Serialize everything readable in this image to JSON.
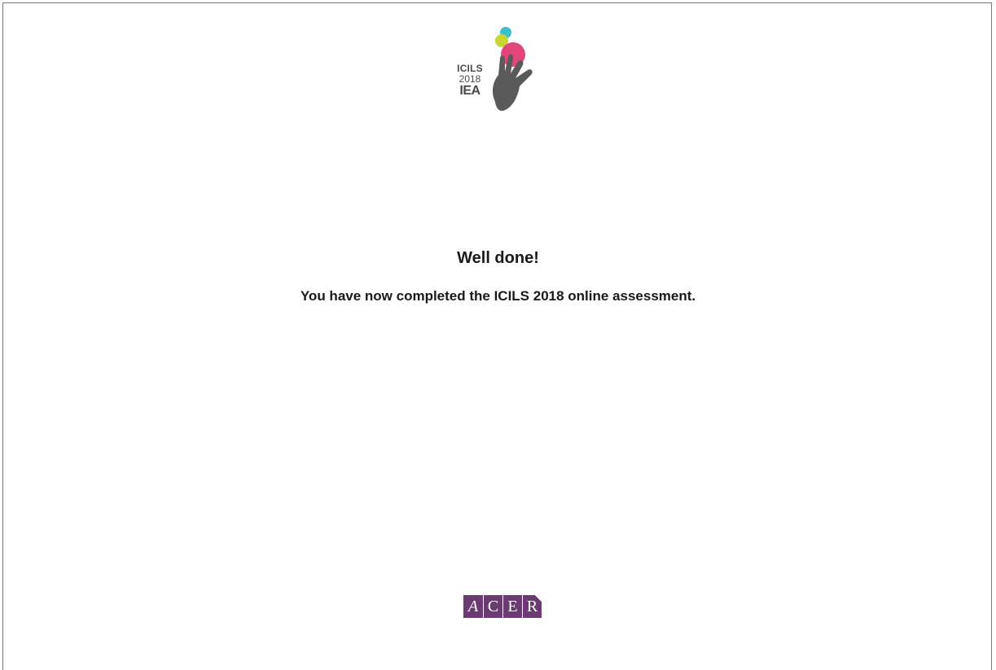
{
  "header_logo": {
    "line1": "ICILS",
    "line2": "2018",
    "line3": "IEA",
    "colors": {
      "teal": "#3bbfd0",
      "yellow_green": "#c8d630",
      "magenta": "#e0457b",
      "hand": "#5a5a5a"
    },
    "icon": "hand-with-colored-dots-icon"
  },
  "completion": {
    "heading": "Well done!",
    "message": "You have now completed the ICILS 2018 online assessment."
  },
  "footer_logo": {
    "letters": [
      "A",
      "C",
      "E",
      "R"
    ],
    "color": "#6b3a72"
  }
}
